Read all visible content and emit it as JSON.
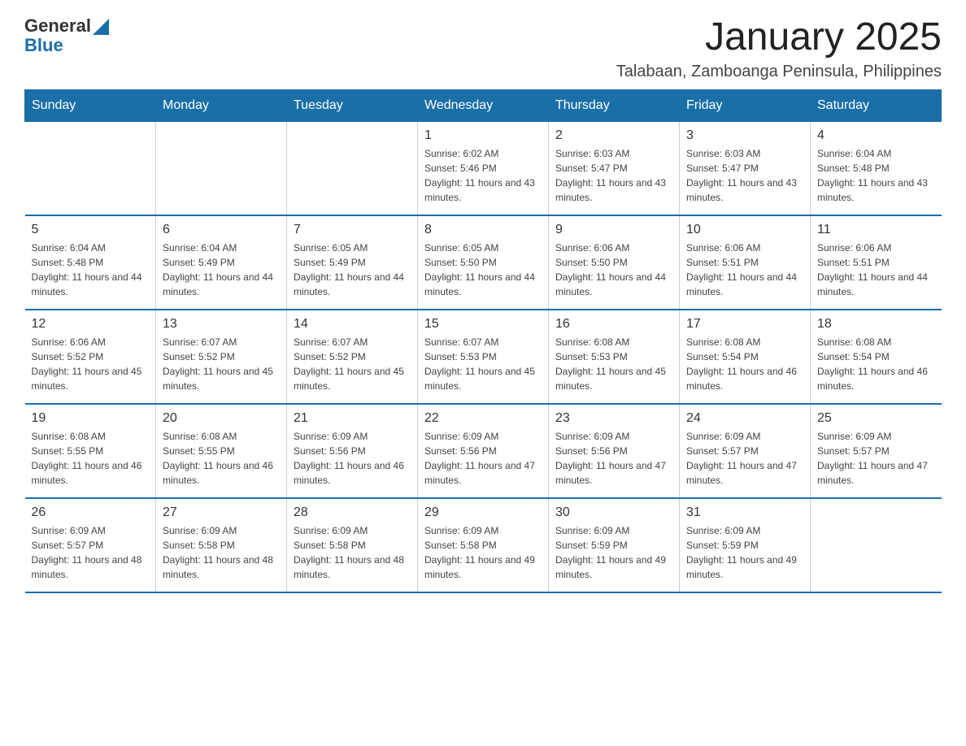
{
  "logo": {
    "general": "General",
    "blue": "Blue"
  },
  "header": {
    "month": "January 2025",
    "location": "Talabaan, Zamboanga Peninsula, Philippines"
  },
  "days_of_week": [
    "Sunday",
    "Monday",
    "Tuesday",
    "Wednesday",
    "Thursday",
    "Friday",
    "Saturday"
  ],
  "weeks": [
    [
      {
        "day": "",
        "info": ""
      },
      {
        "day": "",
        "info": ""
      },
      {
        "day": "",
        "info": ""
      },
      {
        "day": "1",
        "info": "Sunrise: 6:02 AM\nSunset: 5:46 PM\nDaylight: 11 hours and 43 minutes."
      },
      {
        "day": "2",
        "info": "Sunrise: 6:03 AM\nSunset: 5:47 PM\nDaylight: 11 hours and 43 minutes."
      },
      {
        "day": "3",
        "info": "Sunrise: 6:03 AM\nSunset: 5:47 PM\nDaylight: 11 hours and 43 minutes."
      },
      {
        "day": "4",
        "info": "Sunrise: 6:04 AM\nSunset: 5:48 PM\nDaylight: 11 hours and 43 minutes."
      }
    ],
    [
      {
        "day": "5",
        "info": "Sunrise: 6:04 AM\nSunset: 5:48 PM\nDaylight: 11 hours and 44 minutes."
      },
      {
        "day": "6",
        "info": "Sunrise: 6:04 AM\nSunset: 5:49 PM\nDaylight: 11 hours and 44 minutes."
      },
      {
        "day": "7",
        "info": "Sunrise: 6:05 AM\nSunset: 5:49 PM\nDaylight: 11 hours and 44 minutes."
      },
      {
        "day": "8",
        "info": "Sunrise: 6:05 AM\nSunset: 5:50 PM\nDaylight: 11 hours and 44 minutes."
      },
      {
        "day": "9",
        "info": "Sunrise: 6:06 AM\nSunset: 5:50 PM\nDaylight: 11 hours and 44 minutes."
      },
      {
        "day": "10",
        "info": "Sunrise: 6:06 AM\nSunset: 5:51 PM\nDaylight: 11 hours and 44 minutes."
      },
      {
        "day": "11",
        "info": "Sunrise: 6:06 AM\nSunset: 5:51 PM\nDaylight: 11 hours and 44 minutes."
      }
    ],
    [
      {
        "day": "12",
        "info": "Sunrise: 6:06 AM\nSunset: 5:52 PM\nDaylight: 11 hours and 45 minutes."
      },
      {
        "day": "13",
        "info": "Sunrise: 6:07 AM\nSunset: 5:52 PM\nDaylight: 11 hours and 45 minutes."
      },
      {
        "day": "14",
        "info": "Sunrise: 6:07 AM\nSunset: 5:52 PM\nDaylight: 11 hours and 45 minutes."
      },
      {
        "day": "15",
        "info": "Sunrise: 6:07 AM\nSunset: 5:53 PM\nDaylight: 11 hours and 45 minutes."
      },
      {
        "day": "16",
        "info": "Sunrise: 6:08 AM\nSunset: 5:53 PM\nDaylight: 11 hours and 45 minutes."
      },
      {
        "day": "17",
        "info": "Sunrise: 6:08 AM\nSunset: 5:54 PM\nDaylight: 11 hours and 46 minutes."
      },
      {
        "day": "18",
        "info": "Sunrise: 6:08 AM\nSunset: 5:54 PM\nDaylight: 11 hours and 46 minutes."
      }
    ],
    [
      {
        "day": "19",
        "info": "Sunrise: 6:08 AM\nSunset: 5:55 PM\nDaylight: 11 hours and 46 minutes."
      },
      {
        "day": "20",
        "info": "Sunrise: 6:08 AM\nSunset: 5:55 PM\nDaylight: 11 hours and 46 minutes."
      },
      {
        "day": "21",
        "info": "Sunrise: 6:09 AM\nSunset: 5:56 PM\nDaylight: 11 hours and 46 minutes."
      },
      {
        "day": "22",
        "info": "Sunrise: 6:09 AM\nSunset: 5:56 PM\nDaylight: 11 hours and 47 minutes."
      },
      {
        "day": "23",
        "info": "Sunrise: 6:09 AM\nSunset: 5:56 PM\nDaylight: 11 hours and 47 minutes."
      },
      {
        "day": "24",
        "info": "Sunrise: 6:09 AM\nSunset: 5:57 PM\nDaylight: 11 hours and 47 minutes."
      },
      {
        "day": "25",
        "info": "Sunrise: 6:09 AM\nSunset: 5:57 PM\nDaylight: 11 hours and 47 minutes."
      }
    ],
    [
      {
        "day": "26",
        "info": "Sunrise: 6:09 AM\nSunset: 5:57 PM\nDaylight: 11 hours and 48 minutes."
      },
      {
        "day": "27",
        "info": "Sunrise: 6:09 AM\nSunset: 5:58 PM\nDaylight: 11 hours and 48 minutes."
      },
      {
        "day": "28",
        "info": "Sunrise: 6:09 AM\nSunset: 5:58 PM\nDaylight: 11 hours and 48 minutes."
      },
      {
        "day": "29",
        "info": "Sunrise: 6:09 AM\nSunset: 5:58 PM\nDaylight: 11 hours and 49 minutes."
      },
      {
        "day": "30",
        "info": "Sunrise: 6:09 AM\nSunset: 5:59 PM\nDaylight: 11 hours and 49 minutes."
      },
      {
        "day": "31",
        "info": "Sunrise: 6:09 AM\nSunset: 5:59 PM\nDaylight: 11 hours and 49 minutes."
      },
      {
        "day": "",
        "info": ""
      }
    ]
  ]
}
